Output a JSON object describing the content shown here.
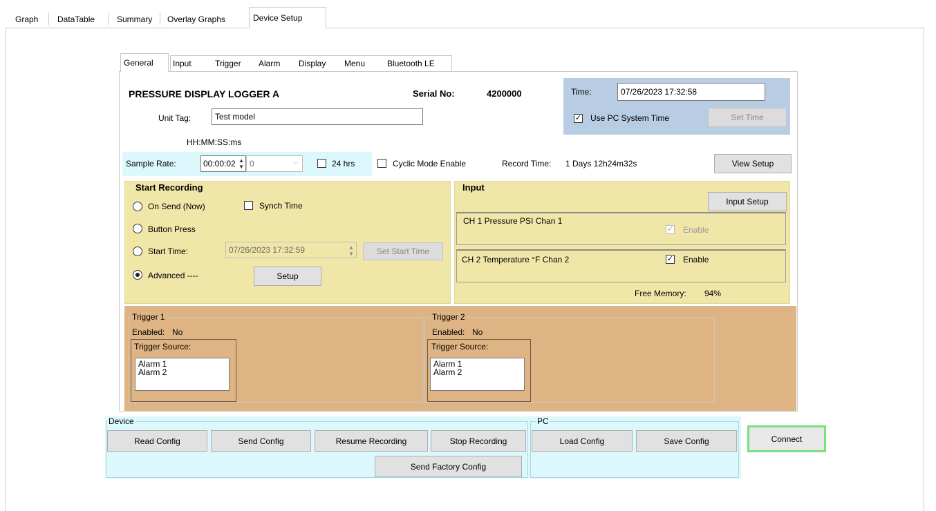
{
  "top_tabs": [
    "Graph",
    "DataTable",
    "Summary",
    "Overlay Graphs",
    "Device Setup"
  ],
  "inner_tabs": [
    "General",
    "Input",
    "Trigger",
    "Alarm",
    "Display",
    "Menu",
    "Bluetooth LE"
  ],
  "general": {
    "device_name": "PRESSURE DISPLAY LOGGER A",
    "serial_label": "Serial No:",
    "serial_value": "4200000",
    "unit_tag_label": "Unit Tag:",
    "unit_tag_value": "Test model",
    "time_label": "Time:",
    "time_value": "07/26/2023 17:32:58",
    "use_pc_time_label": "Use PC System Time",
    "use_pc_time_checked": true,
    "set_time_label": "Set Time",
    "format_hint": "HH:MM:SS:ms",
    "sample_rate_label": "Sample Rate:",
    "sample_rate_value": "00:00:02",
    "ms_value": "0",
    "hrs24_label": "24 hrs",
    "cyclic_label": "Cyclic Mode Enable",
    "record_time_label": "Record Time:",
    "record_time_value": "1 Days 12h24m32s",
    "view_setup_label": "View Setup"
  },
  "start_recording": {
    "title": "Start Recording",
    "on_send_label": "On Send (Now)",
    "synch_time_label": "Synch Time",
    "button_press_label": "Button Press",
    "start_time_label": "Start Time:",
    "start_time_value": "07/26/2023 17:32:59",
    "set_start_time_label": "Set Start Time",
    "advanced_label": "Advanced ----",
    "setup_label": "Setup",
    "selected": "advanced"
  },
  "input": {
    "title": "Input",
    "input_setup_label": "Input Setup",
    "ch1_label": "CH 1 Pressure PSI Chan 1",
    "ch1_enable_label": "Enable",
    "ch2_label": "CH 2 Temperature °F Chan 2",
    "ch2_enable_label": "Enable",
    "free_memory_label": "Free Memory:",
    "free_memory_value": "94%"
  },
  "triggers": [
    {
      "title": "Trigger 1",
      "enabled_label": "Enabled:",
      "enabled_value": "No",
      "source_title": "Trigger Source:",
      "sources": [
        "Alarm 1",
        "Alarm 2"
      ]
    },
    {
      "title": "Trigger 2",
      "enabled_label": "Enabled:",
      "enabled_value": "No",
      "source_title": "Trigger Source:",
      "sources": [
        "Alarm 1",
        "Alarm 2"
      ]
    }
  ],
  "device_group": {
    "title": "Device",
    "read_config": "Read Config",
    "send_config": "Send Config",
    "resume_recording": "Resume Recording",
    "stop_recording": "Stop Recording",
    "send_factory_config": "Send Factory Config"
  },
  "pc_group": {
    "title": "PC",
    "load_config": "Load Config",
    "save_config": "Save Config"
  },
  "connect_label": "Connect",
  "colors": {
    "time_panel": "#b8cce4",
    "sample_rate_panel": "#ddf8fc",
    "start_recording_panel": "#f0e6a8",
    "trigger_panel": "#deb484",
    "bottom_panel": "#ddf8fc",
    "connect_border": "#7ce07c"
  }
}
